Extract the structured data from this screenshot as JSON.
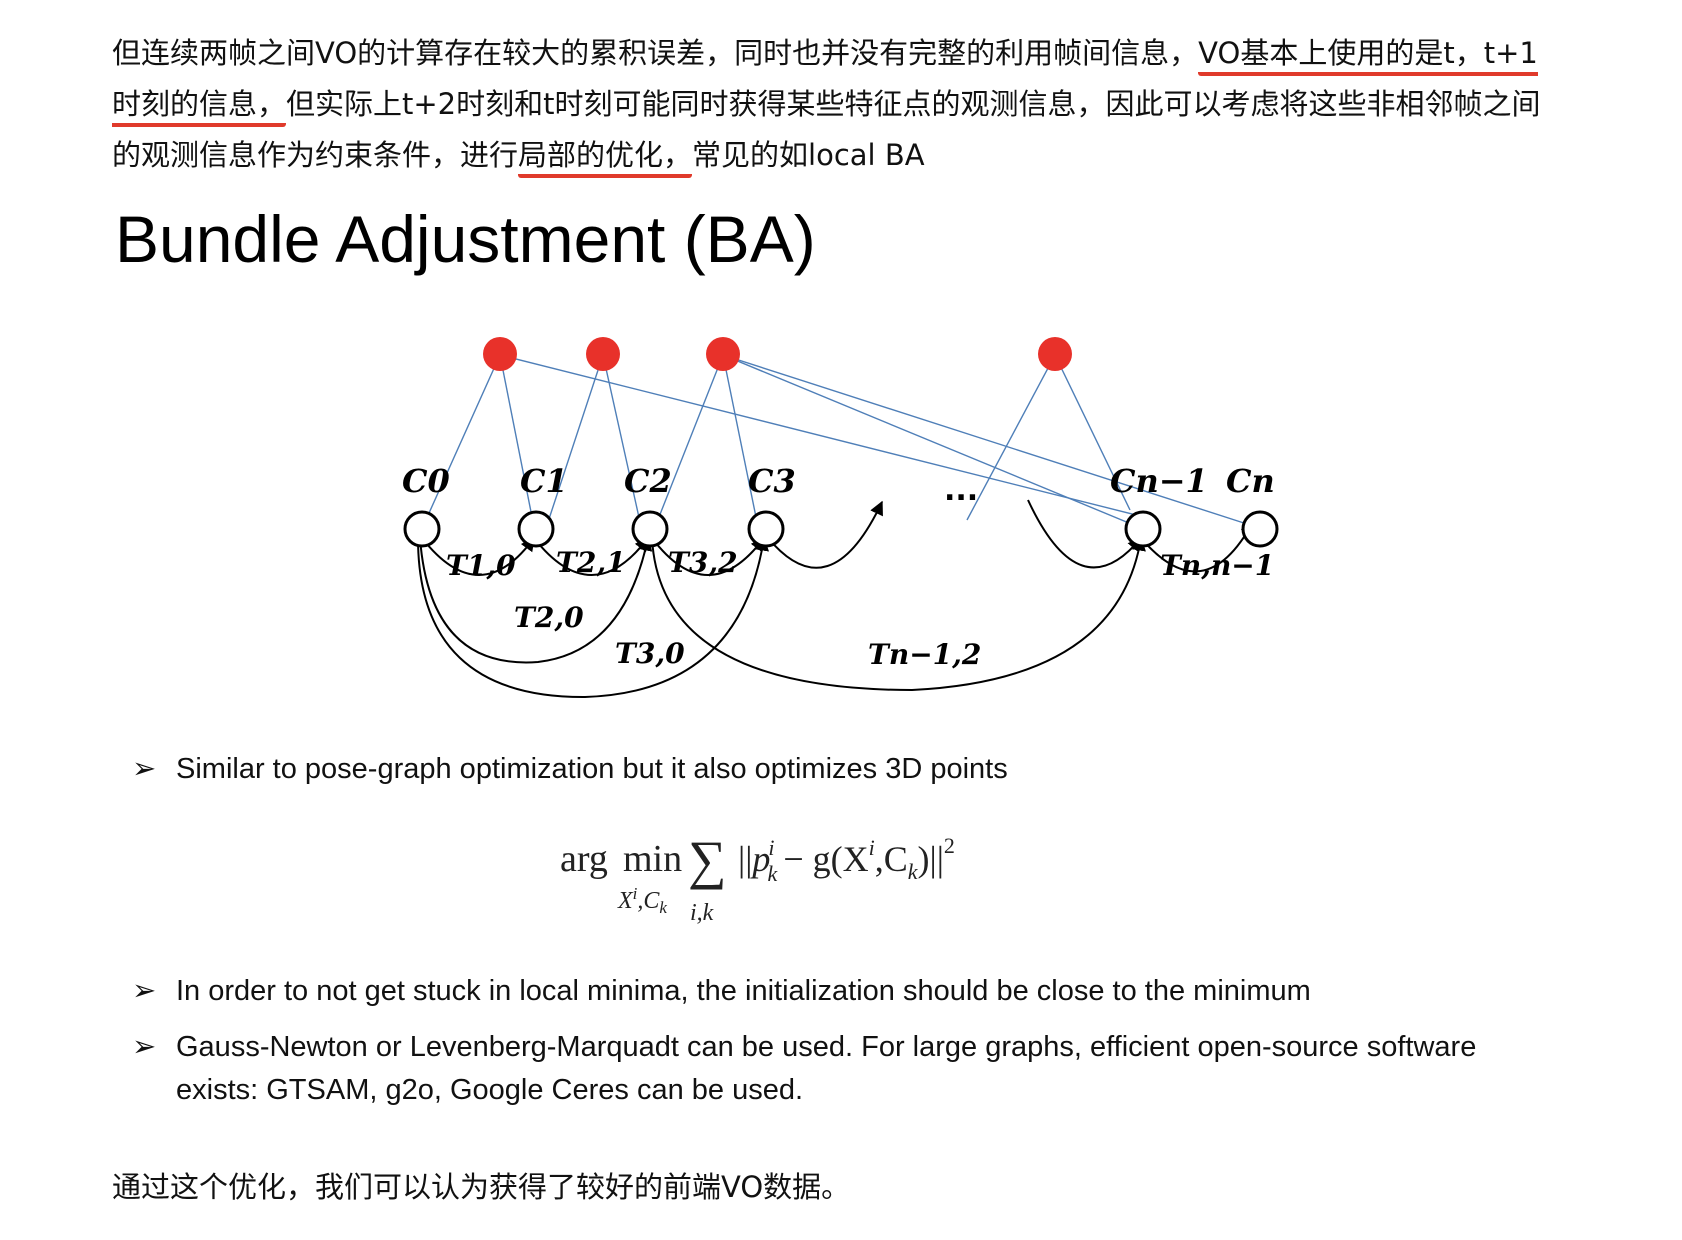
{
  "intro": {
    "part1": "但连续两帧之间VO的计算存在较大的累积误差，同时也并没有完整的利用帧间信息，",
    "highlight1": "VO基本上使用的是t，t+1时刻的信息，",
    "part2": "但实际上t+2时刻和t时刻可能同时获得某些特征点的观测信息，因此可以考虑将这些非相邻帧之间的观测信息作为约束条件，进行",
    "highlight2": "局部的优化，",
    "part3": "常见的如local BA"
  },
  "slide": {
    "title": "Bundle Adjustment (BA)",
    "diagram": {
      "camera_labels": [
        "C0",
        "C1",
        "C2",
        "C3",
        "Cn−1",
        "Cn"
      ],
      "ellipsis": "...",
      "transform_labels": [
        "T1,0",
        "T2,1",
        "T3,2",
        "Tn,n−1",
        "T2,0",
        "T3,0",
        "Tn−1,2"
      ],
      "colors": {
        "landmark": "#e8312a",
        "observation_line": "#4f7fb8",
        "camera": "#000000"
      }
    },
    "bullets": [
      "Similar to pose-graph optimization but it also optimizes 3D points",
      "In order to not get stuck in local minima, the initialization should be close to the minimum",
      "Gauss-Newton or Levenberg-Marquadt can be used. For large graphs, efficient open-source software exists: GTSAM, g2o, Google Ceres can be used."
    ],
    "bullet_marker": "➢",
    "formula": {
      "arg": "arg",
      "min": "min",
      "min_sub": "X",
      "min_sub_sup": "i",
      "min_sub2": ",C",
      "min_sub2_sub": "k",
      "sum_sub": "i,k",
      "norm_open": "||",
      "p": "p",
      "p_sup": "i",
      "p_sub": "k",
      "minus_g": "− g(X",
      "x_sup": "i",
      "c": ",C",
      "c_sub": "k",
      "close": ")||",
      "square": "2"
    }
  },
  "outro": "通过这个优化，我们可以认为获得了较好的前端VO数据。"
}
